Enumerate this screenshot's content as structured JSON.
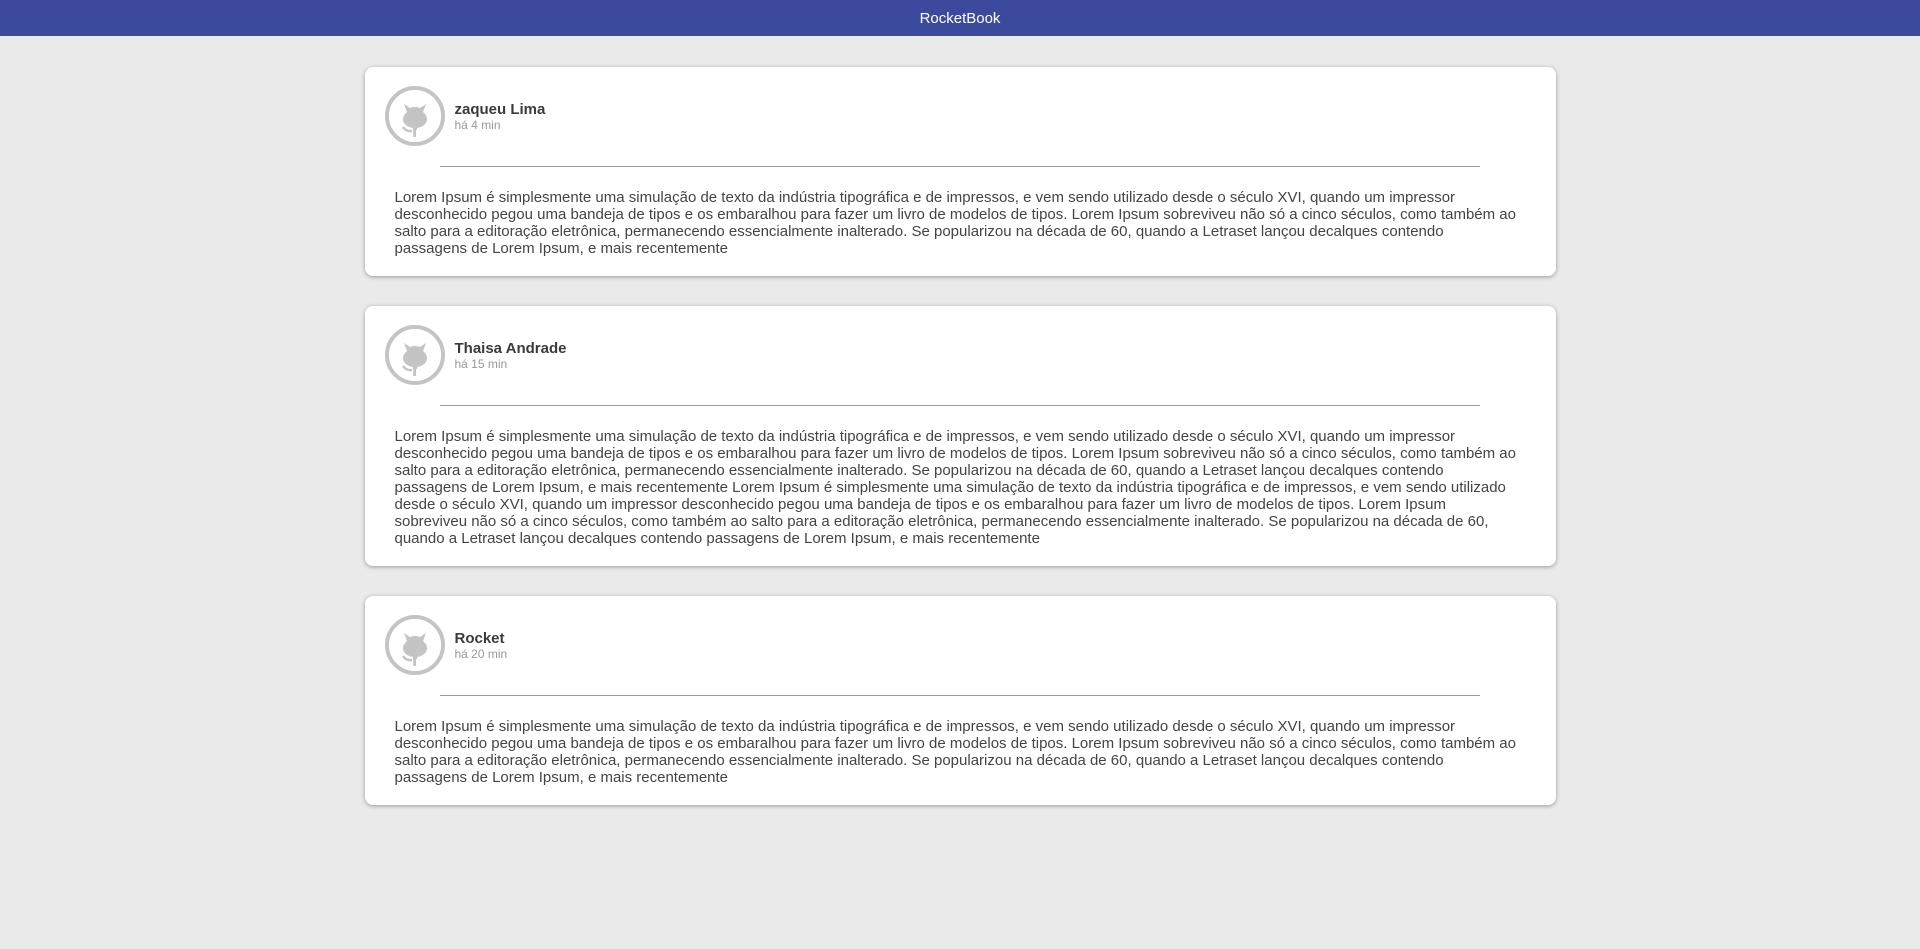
{
  "header": {
    "title": "RocketBook",
    "background": "#3c4a9e"
  },
  "posts": [
    {
      "author": "zaqueu Lima",
      "time": "há 4 min",
      "avatar_icon": "github-octocat-icon",
      "content": "Lorem Ipsum é simplesmente uma simulação de texto da indústria tipográfica e de impressos, e vem sendo utilizado desde o século XVI, quando um impressor desconhecido pegou uma bandeja de tipos e os embaralhou para fazer um livro de modelos de tipos. Lorem Ipsum sobreviveu não só a cinco séculos, como também ao salto para a editoração eletrônica, permanecendo essencialmente inalterado. Se popularizou na década de 60, quando a Letraset lançou decalques contendo passagens de Lorem Ipsum, e mais recentemente"
    },
    {
      "author": "Thaisa Andrade",
      "time": "há 15 min",
      "avatar_icon": "github-octocat-icon",
      "content": "Lorem Ipsum é simplesmente uma simulação de texto da indústria tipográfica e de impressos, e vem sendo utilizado desde o século XVI, quando um impressor desconhecido pegou uma bandeja de tipos e os embaralhou para fazer um livro de modelos de tipos. Lorem Ipsum sobreviveu não só a cinco séculos, como também ao salto para a editoração eletrônica, permanecendo essencialmente inalterado. Se popularizou na década de 60, quando a Letraset lançou decalques contendo passagens de Lorem Ipsum, e mais recentemente Lorem Ipsum é simplesmente uma simulação de texto da indústria tipográfica e de impressos, e vem sendo utilizado desde o século XVI, quando um impressor desconhecido pegou uma bandeja de tipos e os embaralhou para fazer um livro de modelos de tipos. Lorem Ipsum sobreviveu não só a cinco séculos, como também ao salto para a editoração eletrônica, permanecendo essencialmente inalterado. Se popularizou na década de 60, quando a Letraset lançou decalques contendo passagens de Lorem Ipsum, e mais recentemente"
    },
    {
      "author": "Rocket",
      "time": "há 20 min",
      "avatar_icon": "github-octocat-icon",
      "content": "Lorem Ipsum é simplesmente uma simulação de texto da indústria tipográfica e de impressos, e vem sendo utilizado desde o século XVI, quando um impressor desconhecido pegou uma bandeja de tipos e os embaralhou para fazer um livro de modelos de tipos. Lorem Ipsum sobreviveu não só a cinco séculos, como também ao salto para a editoração eletrônica, permanecendo essencialmente inalterado. Se popularizou na década de 60, quando a Letraset lançou decalques contendo passagens de Lorem Ipsum, e mais recentemente"
    }
  ]
}
